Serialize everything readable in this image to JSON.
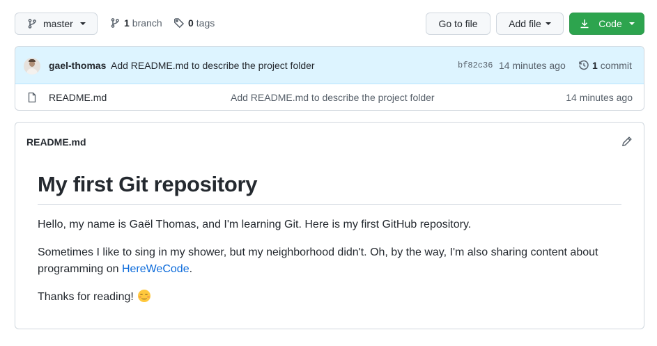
{
  "toolbar": {
    "branch_name": "master",
    "branch_count": "1",
    "branch_label": "branch",
    "tag_count": "0",
    "tag_label": "tags",
    "goto_file_label": "Go to file",
    "add_file_label": "Add file",
    "code_label": "Code"
  },
  "latest_commit": {
    "author": "gael-thomas",
    "message": "Add README.md to describe the project folder",
    "sha": "bf82c36",
    "time": "14 minutes ago",
    "commit_count": "1",
    "commit_label": "commit"
  },
  "files": [
    {
      "name": "README.md",
      "message": "Add README.md to describe the project folder",
      "time": "14 minutes ago",
      "icon": "file-icon"
    }
  ],
  "readme": {
    "filename": "README.md",
    "title": "My first Git repository",
    "p1": "Hello, my name is Gaël Thomas, and I'm learning Git. Here is my first GitHub repository.",
    "p2_before": "Sometimes I like to sing in my shower, but my neighborhood didn't. Oh, by the way, I'm also sharing content about programming on ",
    "p2_link": "HereWeCode",
    "p2_after": ".",
    "p3": "Thanks for reading!",
    "emoji": "smiling-face-icon"
  },
  "colors": {
    "accent_green": "#2da44e",
    "commit_bar": "#ddf4ff",
    "link": "#0969da"
  }
}
